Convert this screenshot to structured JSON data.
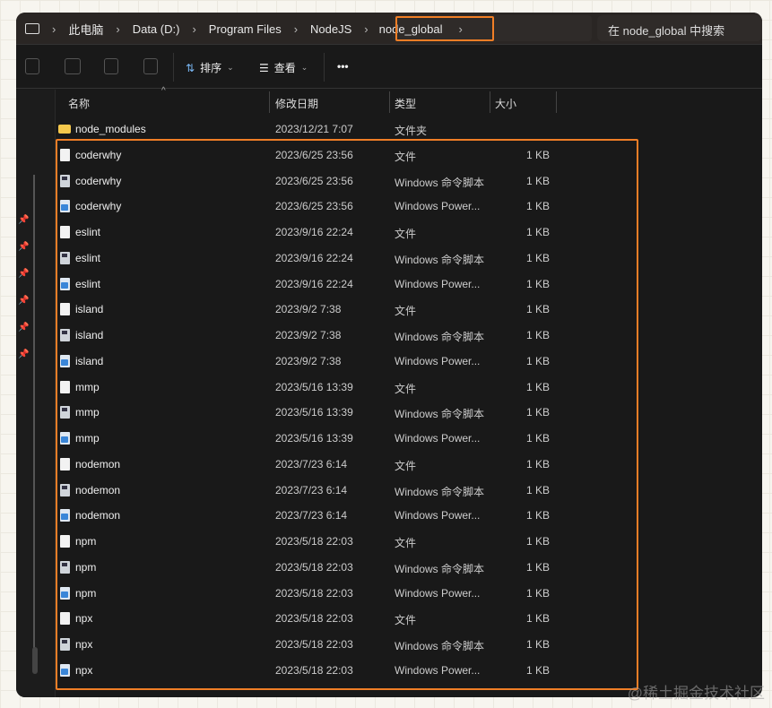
{
  "breadcrumb": [
    "此电脑",
    "Data (D:)",
    "Program Files",
    "NodeJS",
    "node_global"
  ],
  "search": {
    "placeholder": "在 node_global 中搜索"
  },
  "toolbar": {
    "sort_label": "排序",
    "view_label": "查看",
    "more_label": "•••"
  },
  "columns": {
    "name": "名称",
    "date": "修改日期",
    "type": "类型",
    "size": "大小"
  },
  "files": [
    {
      "name": "node_modules",
      "date": "2023/12/21 7:07",
      "type": "文件夹",
      "size": "",
      "icon": "folder"
    },
    {
      "name": "coderwhy",
      "date": "2023/6/25 23:56",
      "type": "文件",
      "size": "1 KB",
      "icon": "file"
    },
    {
      "name": "coderwhy",
      "date": "2023/6/25 23:56",
      "type": "Windows 命令脚本",
      "size": "1 KB",
      "icon": "cmd"
    },
    {
      "name": "coderwhy",
      "date": "2023/6/25 23:56",
      "type": "Windows Power...",
      "size": "1 KB",
      "icon": "ps"
    },
    {
      "name": "eslint",
      "date": "2023/9/16 22:24",
      "type": "文件",
      "size": "1 KB",
      "icon": "file"
    },
    {
      "name": "eslint",
      "date": "2023/9/16 22:24",
      "type": "Windows 命令脚本",
      "size": "1 KB",
      "icon": "cmd"
    },
    {
      "name": "eslint",
      "date": "2023/9/16 22:24",
      "type": "Windows Power...",
      "size": "1 KB",
      "icon": "ps"
    },
    {
      "name": "island",
      "date": "2023/9/2 7:38",
      "type": "文件",
      "size": "1 KB",
      "icon": "file"
    },
    {
      "name": "island",
      "date": "2023/9/2 7:38",
      "type": "Windows 命令脚本",
      "size": "1 KB",
      "icon": "cmd"
    },
    {
      "name": "island",
      "date": "2023/9/2 7:38",
      "type": "Windows Power...",
      "size": "1 KB",
      "icon": "ps"
    },
    {
      "name": "mmp",
      "date": "2023/5/16 13:39",
      "type": "文件",
      "size": "1 KB",
      "icon": "file"
    },
    {
      "name": "mmp",
      "date": "2023/5/16 13:39",
      "type": "Windows 命令脚本",
      "size": "1 KB",
      "icon": "cmd"
    },
    {
      "name": "mmp",
      "date": "2023/5/16 13:39",
      "type": "Windows Power...",
      "size": "1 KB",
      "icon": "ps"
    },
    {
      "name": "nodemon",
      "date": "2023/7/23 6:14",
      "type": "文件",
      "size": "1 KB",
      "icon": "file"
    },
    {
      "name": "nodemon",
      "date": "2023/7/23 6:14",
      "type": "Windows 命令脚本",
      "size": "1 KB",
      "icon": "cmd"
    },
    {
      "name": "nodemon",
      "date": "2023/7/23 6:14",
      "type": "Windows Power...",
      "size": "1 KB",
      "icon": "ps"
    },
    {
      "name": "npm",
      "date": "2023/5/18 22:03",
      "type": "文件",
      "size": "1 KB",
      "icon": "file"
    },
    {
      "name": "npm",
      "date": "2023/5/18 22:03",
      "type": "Windows 命令脚本",
      "size": "1 KB",
      "icon": "cmd"
    },
    {
      "name": "npm",
      "date": "2023/5/18 22:03",
      "type": "Windows Power...",
      "size": "1 KB",
      "icon": "ps"
    },
    {
      "name": "npx",
      "date": "2023/5/18 22:03",
      "type": "文件",
      "size": "1 KB",
      "icon": "file"
    },
    {
      "name": "npx",
      "date": "2023/5/18 22:03",
      "type": "Windows 命令脚本",
      "size": "1 KB",
      "icon": "cmd"
    },
    {
      "name": "npx",
      "date": "2023/5/18 22:03",
      "type": "Windows Power...",
      "size": "1 KB",
      "icon": "ps"
    }
  ],
  "watermark": "@稀土掘金技术社区",
  "colors": {
    "highlight": "#f07e26"
  }
}
